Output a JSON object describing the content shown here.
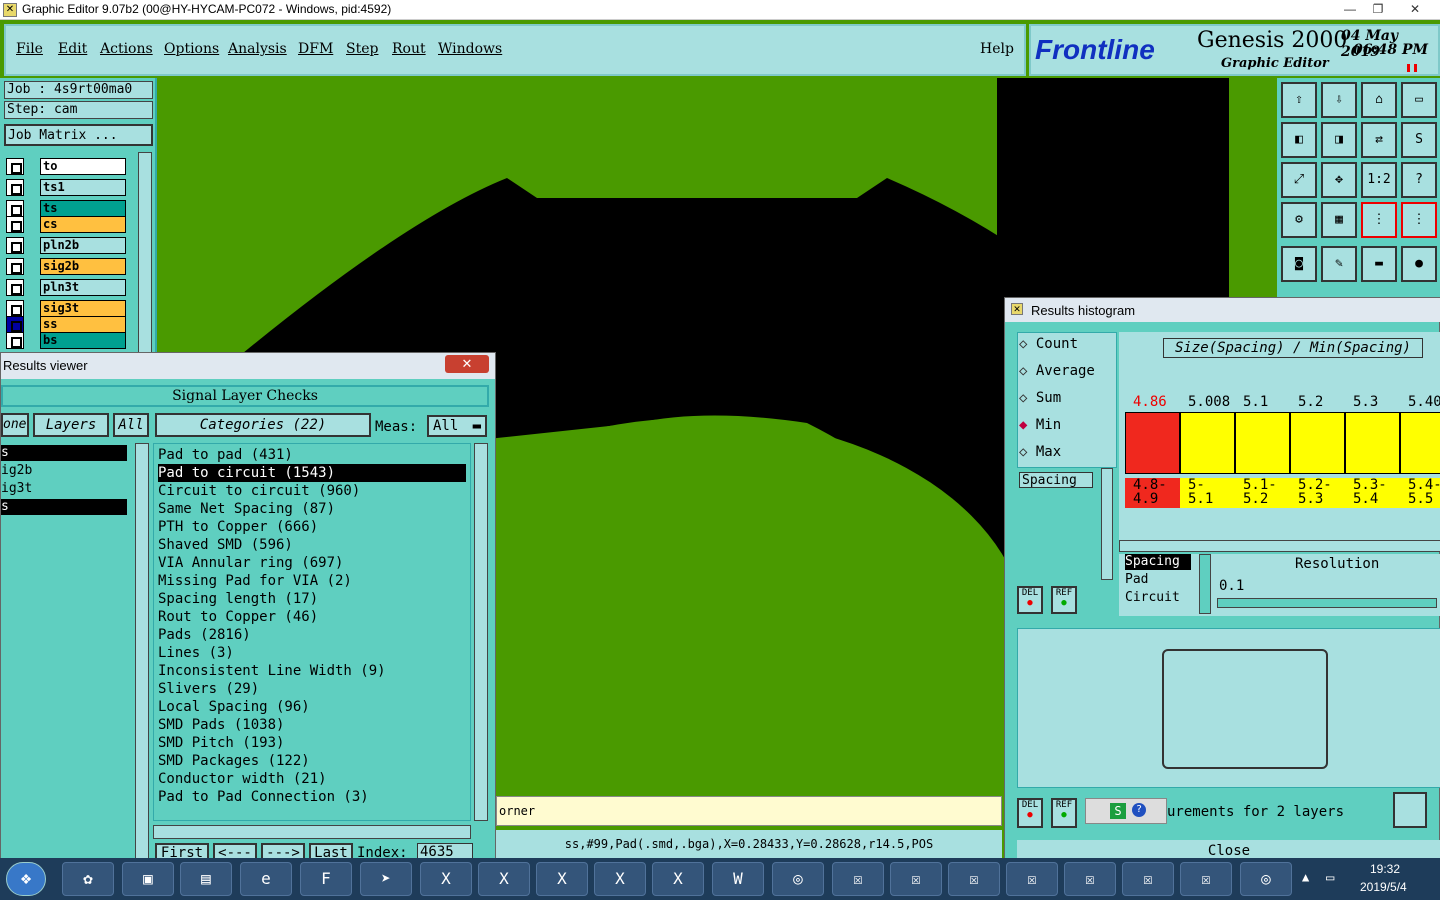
{
  "window": {
    "title": "Graphic Editor 9.07b2 (00@HY-HYCAM-PC072 - Windows, pid:4592)",
    "minimize_label": "—",
    "restore_label": "❐",
    "close_label": "✕"
  },
  "menu": {
    "items": [
      "File",
      "Edit",
      "Actions",
      "Options",
      "Analysis",
      "DFM",
      "Step",
      "Rout",
      "Windows"
    ],
    "help": "Help"
  },
  "brand": {
    "logo": "Frontline",
    "product": "Genesis 2000",
    "subtitle": "Graphic Editor",
    "date": "04 May 2019",
    "time": "06:48 PM"
  },
  "job": {
    "job_label": "Job  : 4s9rt00ma0",
    "step_label": "Step: cam",
    "matrix_button": "Job Matrix ..."
  },
  "layers": [
    {
      "name": "to",
      "color": "#ffffff"
    },
    {
      "name": "ts1",
      "color": "#a8e0e0"
    },
    {
      "name": "ts",
      "color": "#00a090"
    },
    {
      "name": "cs",
      "color": "#ffc040"
    },
    {
      "name": "pln2b",
      "color": "#a8e0e0"
    },
    {
      "name": "sig2b",
      "color": "#ffc040"
    },
    {
      "name": "pln3t",
      "color": "#a8e0e0"
    },
    {
      "name": "sig3t",
      "color": "#ffc040"
    },
    {
      "name": "ss",
      "color": "#ffc040"
    },
    {
      "name": "bs",
      "color": "#00a090"
    }
  ],
  "results_viewer": {
    "title": "Results viewer",
    "header": "Signal Layer Checks",
    "none_btn": "one",
    "layers_btn": "Layers",
    "all_btn": "All",
    "left_list": [
      "s",
      "ig2b",
      "ig3t",
      "s"
    ],
    "categories_label": "Categories (22)",
    "meas_label": "Meas:",
    "meas_value": "All",
    "categories": [
      "Pad to pad (431)",
      "Pad to circuit (1543)",
      "Circuit to circuit (960)",
      "Same Net Spacing (87)",
      "PTH to Copper (666)",
      "Shaved SMD (596)",
      "VIA Annular ring (697)",
      "Missing Pad for VIA (2)",
      "Spacing length (17)",
      "Rout to Copper (46)",
      "Pads (2816)",
      "Lines (3)",
      "Inconsistent Line Width (9)",
      "Slivers (29)",
      "Local Spacing (96)",
      "SMD Pads (1038)",
      "SMD Pitch (193)",
      "SMD Packages (122)",
      "Conductor width (21)",
      "Pad to Pad Connection (3)"
    ],
    "selected_index": 1,
    "nav": {
      "first": "First",
      "prev": "<---",
      "next": "--->",
      "last": "Last",
      "index_label": "Index:",
      "index_value": "4635"
    }
  },
  "status": {
    "hint": "orner",
    "coords": "ss,#99,Pad(.smd,.bga),X=0.28433,Y=0.28628,r14.5,POS"
  },
  "histogram": {
    "title": "Results histogram",
    "modes": [
      "Count",
      "Average",
      "Sum",
      "Min",
      "Max"
    ],
    "selected_mode": "Min",
    "measure_tag": "Spacing",
    "expr": "Size(Spacing) / Min(Spacing)",
    "bars": [
      {
        "value": "4.86",
        "range": "4.8-\n4.9",
        "color": "#f0281e"
      },
      {
        "value": "5.008",
        "range": "5-\n5.1",
        "color": "#ffff00"
      },
      {
        "value": "5.1",
        "range": "5.1-\n5.2",
        "color": "#ffff00"
      },
      {
        "value": "5.2",
        "range": "5.2-\n5.3",
        "color": "#ffff00"
      },
      {
        "value": "5.3",
        "range": "5.3-\n5.4",
        "color": "#ffff00"
      },
      {
        "value": "5.40",
        "range": "5.4-\n5.5",
        "color": "#ffff00"
      }
    ],
    "list": [
      "Spacing",
      "Pad",
      "Circuit"
    ],
    "resolution_label": "Resolution",
    "resolution_value": "0.1",
    "del": "DEL",
    "ref": "REF",
    "footer": "urements for 2 layers",
    "close": "Close"
  },
  "taskbar": {
    "time": "19:32",
    "date": "2019/5/4"
  }
}
